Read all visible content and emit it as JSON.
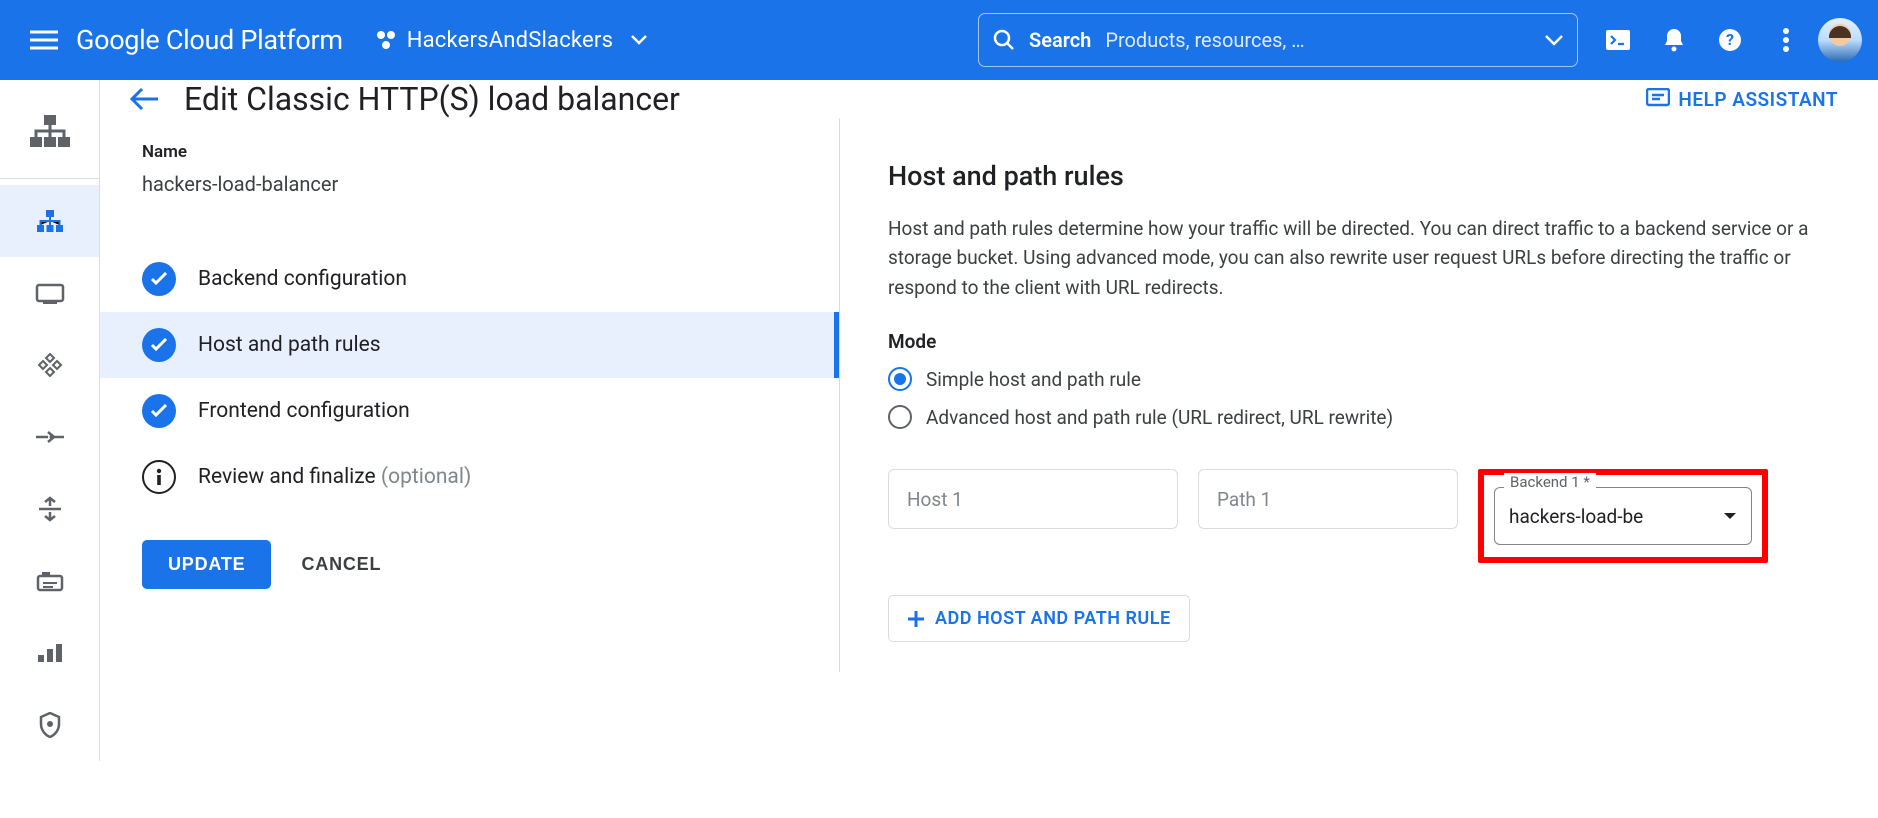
{
  "header": {
    "logo": "Google Cloud Platform",
    "project": "HackersAndSlackers",
    "search_label": "Search",
    "search_placeholder": "Products, resources, …"
  },
  "page": {
    "title": "Edit Classic HTTP(S) load balancer",
    "help": "HELP ASSISTANT",
    "name_label": "Name",
    "name_value": "hackers-load-balancer",
    "steps": {
      "backend": "Backend configuration",
      "hostpath": "Host and path rules",
      "frontend": "Frontend configuration",
      "review": "Review and finalize",
      "review_optional": "(optional)"
    },
    "update_btn": "UPDATE",
    "cancel_btn": "CANCEL"
  },
  "right": {
    "title": "Host and path rules",
    "desc": "Host and path rules determine how your traffic will be directed. You can direct traffic to a backend service or a storage bucket. Using advanced mode, you can also rewrite user request URLs before directing the traffic or respond to the client with URL redirects.",
    "mode_label": "Mode",
    "mode_simple": "Simple host and path rule",
    "mode_advanced": "Advanced host and path rule (URL redirect, URL rewrite)",
    "host_ph": "Host 1",
    "path_ph": "Path 1",
    "backend_label": "Backend 1 *",
    "backend_value": "hackers-load-be",
    "add_rule": "ADD HOST AND PATH RULE"
  }
}
